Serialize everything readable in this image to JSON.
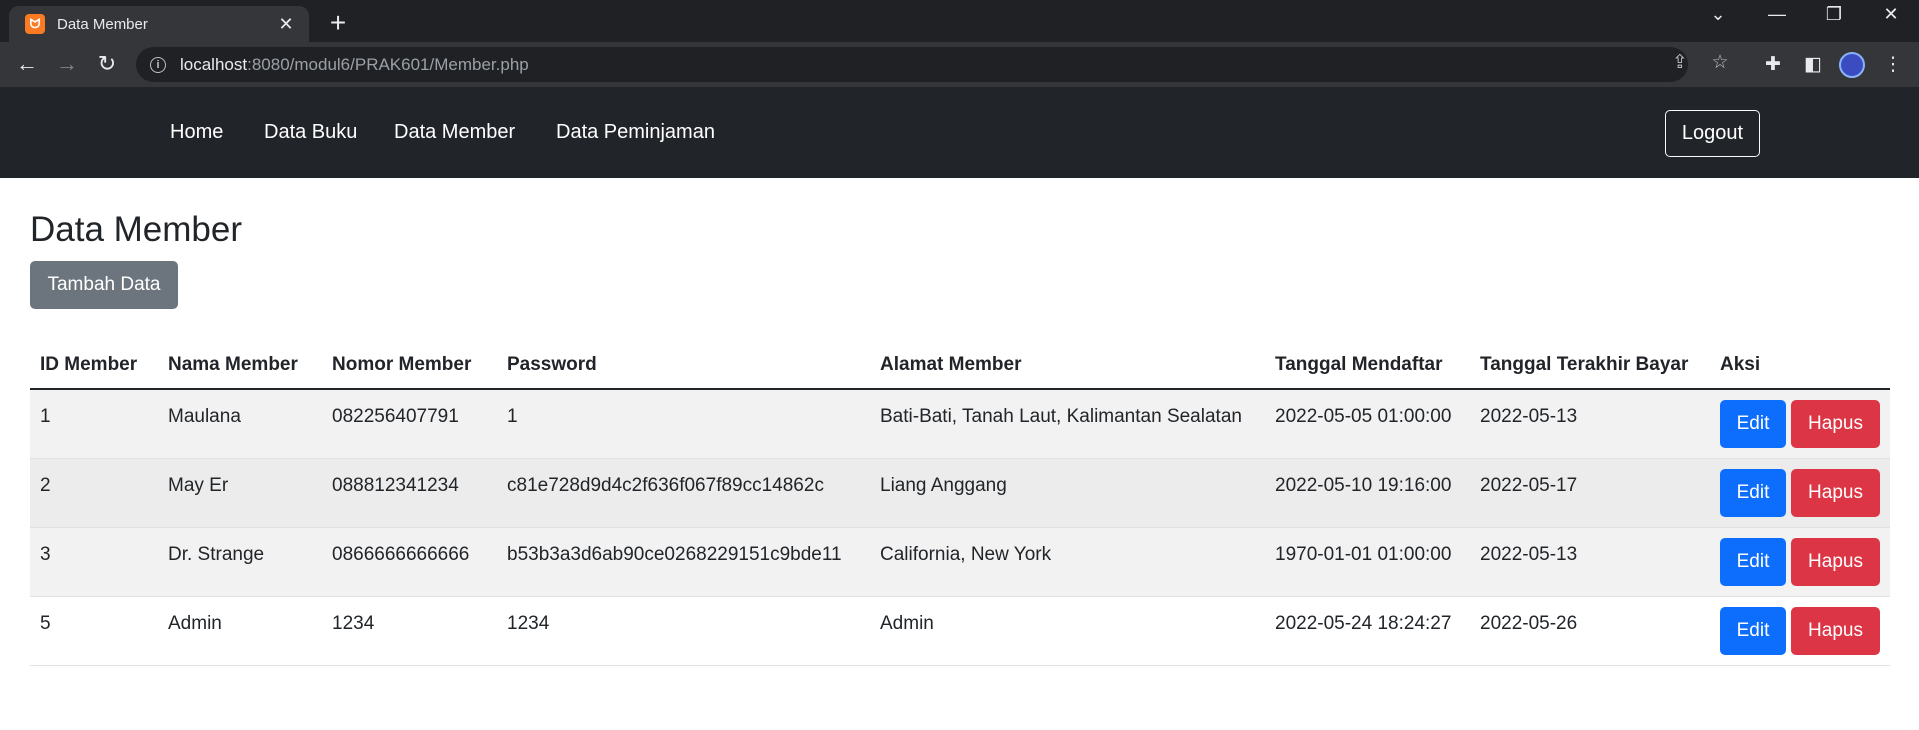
{
  "browser": {
    "tab_title": "Data Member",
    "favicon_glyph": "ᗢ",
    "url_host": "localhost",
    "url_path": ":8080/modul6/PRAK601/Member.php"
  },
  "navbar": {
    "links": [
      "Home",
      "Data Buku",
      "Data Member",
      "Data Peminjaman"
    ],
    "logout_label": "Logout"
  },
  "page": {
    "title": "Data Member",
    "add_button_label": "Tambah Data"
  },
  "table": {
    "headers": [
      "ID Member",
      "Nama Member",
      "Nomor Member",
      "Password",
      "Alamat Member",
      "Tanggal Mendaftar",
      "Tanggal Terakhir Bayar",
      "Aksi"
    ],
    "edit_label": "Edit",
    "delete_label": "Hapus",
    "rows": [
      [
        "1",
        "Maulana",
        "082256407791",
        "1",
        "Bati-Bati, Tanah Laut, Kalimantan Sealatan",
        "2022-05-05 01:00:00",
        "2022-05-13"
      ],
      [
        "2",
        "May Er",
        "088812341234",
        "c81e728d9d4c2f636f067f89cc14862c",
        "Liang Anggang",
        "2022-05-10 19:16:00",
        "2022-05-17"
      ],
      [
        "3",
        "Dr. Strange",
        "0866666666666",
        "b53b3a3d6ab90ce0268229151c9bde11",
        "California, New York",
        "1970-01-01 01:00:00",
        "2022-05-13"
      ],
      [
        "5",
        "Admin",
        "1234",
        "1234",
        "Admin",
        "2022-05-24 18:24:27",
        "2022-05-26"
      ]
    ]
  },
  "colors": {
    "navbar_bg": "#212529",
    "edit_button": "#0d6efd",
    "delete_button": "#dc3545",
    "add_button": "#6c757d"
  }
}
